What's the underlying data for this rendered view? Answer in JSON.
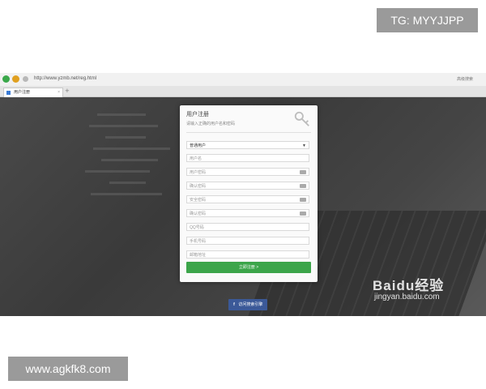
{
  "badges": {
    "tg": "TG: MYYJJPP",
    "site": "www.agkfk8.com"
  },
  "browser": {
    "address": "http://www.yzmb.net/reg.html",
    "address_right": "高级搜索",
    "tab_label": "用户注册",
    "tab_close": "×",
    "new_tab": "+"
  },
  "form": {
    "title": "用户注册",
    "subtitle": "请输入正确的用户名和密码",
    "user_type": "普通用户",
    "fields": [
      {
        "placeholder": "用户名"
      },
      {
        "placeholder": "用户密码"
      },
      {
        "placeholder": "确认密码"
      },
      {
        "placeholder": "安全密码"
      },
      {
        "placeholder": "确认密码"
      },
      {
        "placeholder": "QQ号码"
      },
      {
        "placeholder": "手机号码"
      },
      {
        "placeholder": "邮箱地址"
      }
    ],
    "submit_label": "立即注册 >",
    "facebook_label": "访问搜索引擎"
  },
  "watermark": {
    "logo": "Baidu经验",
    "site": "jingyan.baidu.com"
  },
  "colors": {
    "submit_green": "#3ca54a",
    "facebook_blue": "#3b5998",
    "badge_gray": "#9a9a9a"
  }
}
